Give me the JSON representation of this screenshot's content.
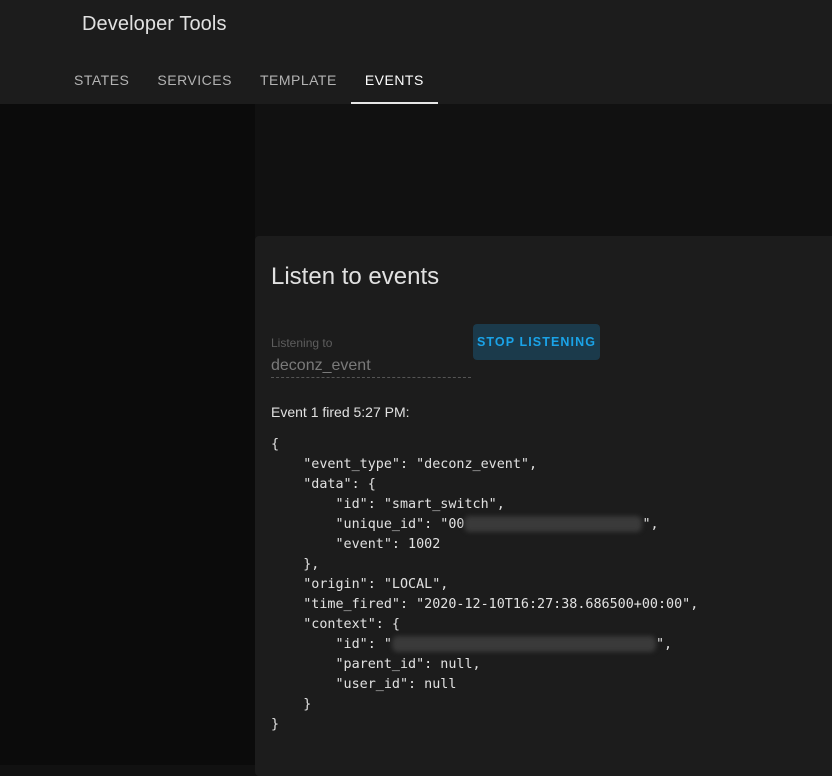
{
  "header": {
    "title": "Developer Tools",
    "tabs": [
      {
        "label": "STATES",
        "active": false
      },
      {
        "label": "SERVICES",
        "active": false
      },
      {
        "label": "TEMPLATE",
        "active": false
      },
      {
        "label": "EVENTS",
        "active": true
      }
    ]
  },
  "card": {
    "title": "Listen to events",
    "listen_field": {
      "label": "Listening to",
      "value": "deconz_event"
    },
    "stop_button_label": "STOP LISTENING",
    "event_header": "Event 1 fired 5:27 PM:",
    "event_lines": {
      "l1": "{",
      "l2": "    \"event_type\": \"deconz_event\",",
      "l3": "    \"data\": {",
      "l4": "        \"id\": \"smart_switch\",",
      "l5a": "        \"unique_id\": \"00",
      "l5b": "\",",
      "l6": "        \"event\": 1002",
      "l7": "    },",
      "l8": "    \"origin\": \"LOCAL\",",
      "l9": "    \"time_fired\": \"2020-12-10T16:27:38.686500+00:00\",",
      "l10": "    \"context\": {",
      "l11a": "        \"id\": \"",
      "l11b": "\",",
      "l12": "        \"parent_id\": null,",
      "l13": "        \"user_id\": null",
      "l14": "    }",
      "l15": "}"
    }
  },
  "colors": {
    "accent": "#1aa3e8",
    "header_bg": "#1c1c1c",
    "card_bg": "#1c1c1c",
    "page_bg": "#111111"
  }
}
